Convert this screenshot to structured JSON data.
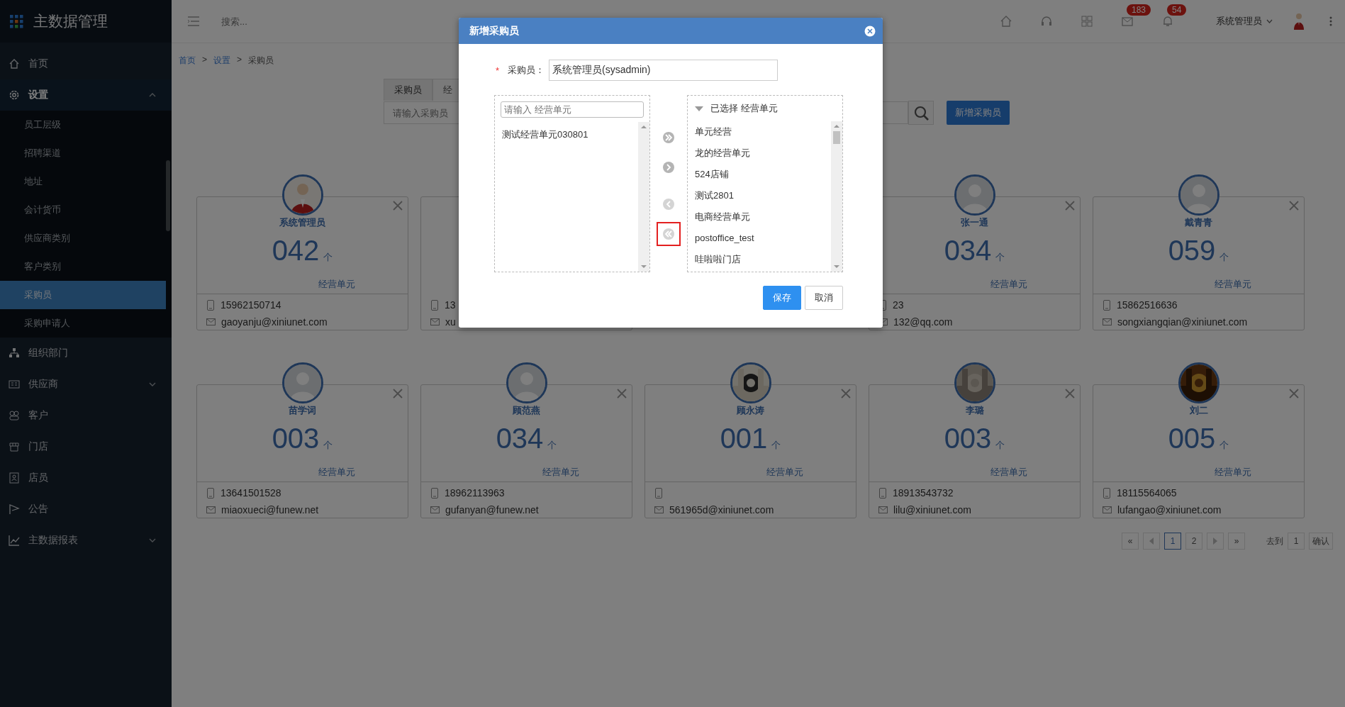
{
  "sidebar": {
    "logo": "主数据管理",
    "items": [
      {
        "label": "首页"
      },
      {
        "label": "设置",
        "expanded": true,
        "children": [
          {
            "label": "员工层级",
            "selected": false
          },
          {
            "label": "招聘渠道",
            "selected": false
          },
          {
            "label": "地址",
            "selected": false
          },
          {
            "label": "会计货币",
            "selected": false
          },
          {
            "label": "供应商类别",
            "selected": false
          },
          {
            "label": "客户类别",
            "selected": false
          },
          {
            "label": "采购员",
            "selected": true
          },
          {
            "label": "采购申请人",
            "selected": false
          }
        ]
      },
      {
        "label": "组织部门"
      },
      {
        "label": "供应商",
        "expanded": false
      },
      {
        "label": "客户"
      },
      {
        "label": "门店"
      },
      {
        "label": "店员"
      },
      {
        "label": "公告"
      },
      {
        "label": "主数据报表",
        "expanded": false
      }
    ]
  },
  "topbar": {
    "search_placeholder": "搜索...",
    "badges": [
      "183",
      "54"
    ],
    "user": "系统管理员"
  },
  "breadcrumb": [
    {
      "kind": "link",
      "text": "首页"
    },
    {
      "kind": "sep",
      "text": ">"
    },
    {
      "kind": "link",
      "text": "设置"
    },
    {
      "kind": "sep",
      "text": ">"
    },
    {
      "kind": "current",
      "text": "采购员"
    }
  ],
  "tabs": [
    {
      "label": "采购员",
      "selected": true
    },
    {
      "label": "经",
      "selected": false
    }
  ],
  "search": {
    "placeholder": "请输入采购员"
  },
  "add_button": "新增采购员",
  "card_rows": [
    [
      {
        "kind": "figure",
        "name": "系统管理员",
        "count": "042",
        "unit": "个",
        "label": "经营单元",
        "phone": "15962150714",
        "email": "gaoyanju@xiniunet.com"
      },
      {
        "kind": "covered",
        "phone": "13",
        "email": "xu"
      },
      {
        "kind": "silhouette",
        "name": "张一通",
        "count": "034",
        "unit": "个",
        "label": "经营单元",
        "phone": "23",
        "email": "132@qq.com"
      },
      {
        "kind": "silhouette",
        "name": "戴青青",
        "count": "059",
        "unit": "个",
        "label": "经营单元",
        "phone": "15862516636",
        "email": "songxiangqian@xiniunet.com"
      }
    ],
    [
      {
        "kind": "silhouette",
        "name": "苗学词",
        "count": "003",
        "unit": "个",
        "label": "经营单元",
        "phone": "13641501528",
        "email": "miaoxueci@funew.net"
      },
      {
        "kind": "silhouette",
        "name": "顾范燕",
        "count": "034",
        "unit": "个",
        "label": "经营单元",
        "phone": "18962113963",
        "email": "gufanyan@funew.net"
      },
      {
        "kind": "picture",
        "name": "顾永涛",
        "count": "001",
        "unit": "个",
        "label": "经营单元",
        "email": "561965d@xiniunet.com"
      },
      {
        "kind": "picture",
        "name": "李璐",
        "count": "003",
        "unit": "个",
        "label": "经营单元",
        "phone": "18913543732",
        "email": "lilu@xiniunet.com"
      },
      {
        "kind": "picture",
        "name": "刘二",
        "count": "005",
        "unit": "个",
        "label": "经营单元",
        "phone": "18115564065",
        "email": "lufangao@xiniunet.com"
      }
    ]
  ],
  "pagination": {
    "first": "«",
    "pages": [
      {
        "label": "1",
        "selected": true
      },
      {
        "label": "2",
        "selected": false
      }
    ],
    "last": "»",
    "goto_label": "去到",
    "goto_value": "1",
    "confirm": "确认"
  },
  "modal": {
    "title": "新增采购员",
    "required_mark": "*",
    "buyer_label": "采购员：",
    "buyer_value": "系统管理员(sysadmin)",
    "left": {
      "placeholder": "请输入 经营单元",
      "items": [
        "测试经营单元030801"
      ]
    },
    "arrows": [
      {
        "disabled": false,
        "highlighted": false
      },
      {
        "disabled": false,
        "highlighted": false
      },
      {
        "disabled": true,
        "highlighted": false
      },
      {
        "disabled": true,
        "highlighted": true
      }
    ],
    "right": {
      "title": "已选择 经营单元",
      "items": [
        "单元经营",
        "龙的经营单元",
        "524店铺",
        "测试2801",
        "电商经营单元",
        "postoffice_test",
        "哇啦啦门店"
      ]
    },
    "buttons": [
      {
        "label": "保存",
        "kind": "primary"
      },
      {
        "label": "取消",
        "kind": "default"
      }
    ]
  }
}
